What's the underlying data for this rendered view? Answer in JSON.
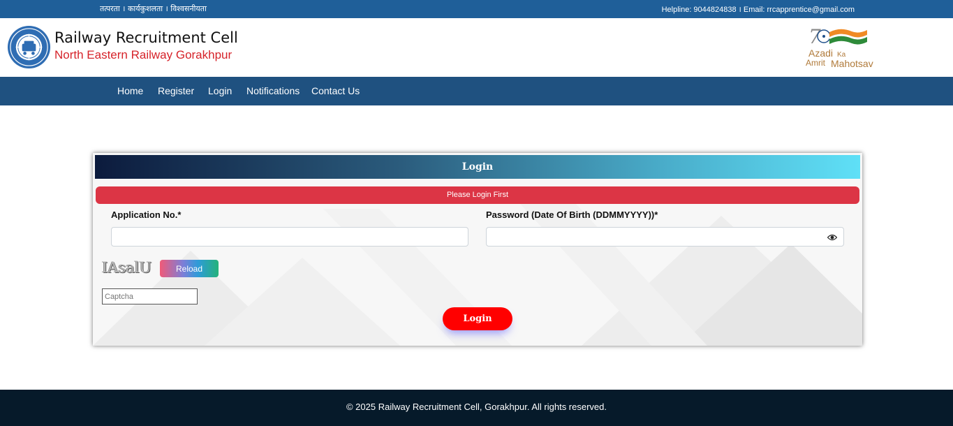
{
  "topbar": {
    "motto": "तत्परता । कार्यकुशलता । विश्वसनीयता",
    "contact": "Helpline: 9044824838 । Email: rrcapprentice@gmail.com"
  },
  "header": {
    "title": "Railway Recruitment Cell",
    "subtitle": "North Eastern Railway Gorakhpur",
    "azadi": {
      "line1": "Azadi",
      "line2": "Ka",
      "line3": "Amrit",
      "line4": "Mahotsav"
    }
  },
  "nav": {
    "items": [
      {
        "label": "Home"
      },
      {
        "label": "Register"
      },
      {
        "label": "Login"
      },
      {
        "label": "Notifications"
      },
      {
        "label": "Contact Us"
      }
    ]
  },
  "login_form": {
    "title": "Login",
    "alert": "Please Login First",
    "application_label": "Application No.*",
    "application_value": "",
    "password_label": "Password (Date Of Birth (DDMMYYYY))*",
    "password_value": "",
    "captcha_text": "IAsalU",
    "reload_label": "Reload",
    "captcha_placeholder": "Captcha",
    "submit_label": "Login"
  },
  "footer": {
    "copyright": "© 2025 Railway Recruitment Cell, Gorakhpur. All rights reserved."
  },
  "colors": {
    "topbar": "#1f5f99",
    "nav": "#1f5180",
    "alert": "#dc3545",
    "login_button": "#ff0000",
    "footer": "#061a2a",
    "brand_subtitle": "#d6232a"
  }
}
